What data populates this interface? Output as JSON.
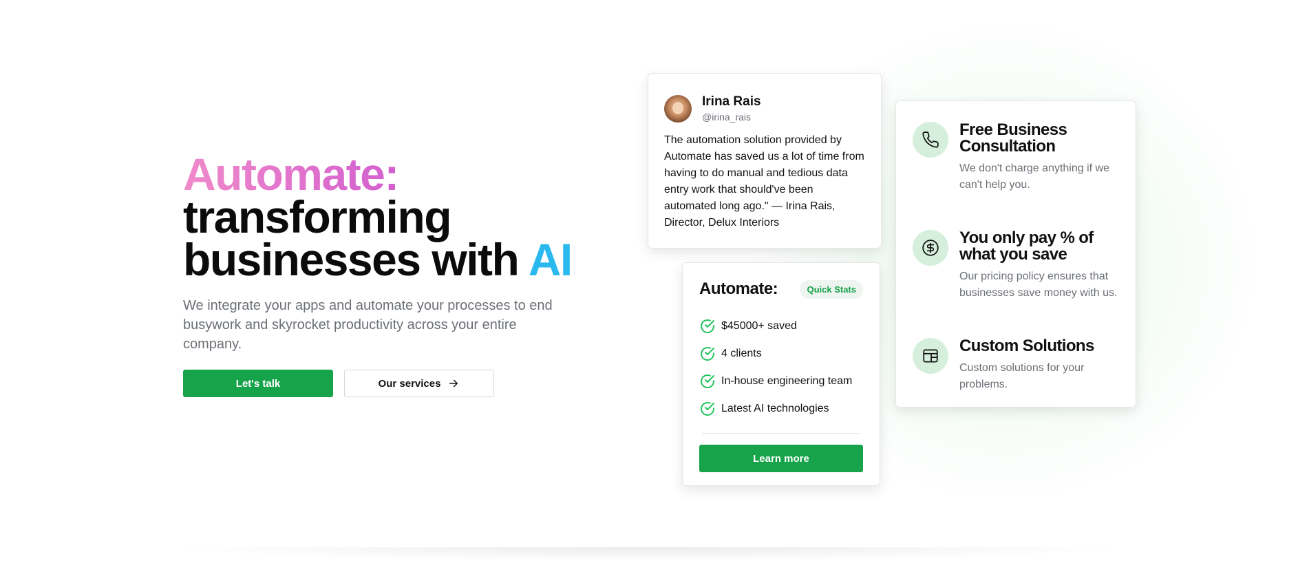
{
  "hero": {
    "title_brand": "Automate:",
    "title_part1": "transforming businesses with",
    "title_ai": "AI",
    "subtitle": "We integrate your apps and automate your processes to end busywork and skyrocket productivity across your entire company.",
    "primary_button": "Let's talk",
    "secondary_button": "Our services"
  },
  "testimonial": {
    "name": "Irina Rais",
    "handle": "@irina_rais",
    "quote": "The automation solution provided by Automate has saved us a lot of time from having to do manual and tedious data entry work that should've been automated long ago.\" — Irina Rais, Director, Delux Interiors"
  },
  "stats": {
    "title": "Automate:",
    "badge": "Quick Stats",
    "items": [
      "$45000+ saved",
      "4 clients",
      "In-house engineering team",
      "Latest AI technologies"
    ],
    "button": "Learn more"
  },
  "features": [
    {
      "icon": "phone-icon",
      "title": "Free Business Consultation",
      "text": "We don't charge anything if we can't help you."
    },
    {
      "icon": "dollar-icon",
      "title": "You only pay % of what you save",
      "text": "Our pricing policy ensures that businesses save money with us."
    },
    {
      "icon": "layout-icon",
      "title": "Custom Solutions",
      "text": "Custom solutions for your problems."
    }
  ],
  "colors": {
    "accent": "#16a34a",
    "brand_gradient_start": "#f08ac9",
    "brand_gradient_end": "#d35fd0",
    "ai_word": "#2ab9ee",
    "icon_bg": "#d5efdc"
  }
}
